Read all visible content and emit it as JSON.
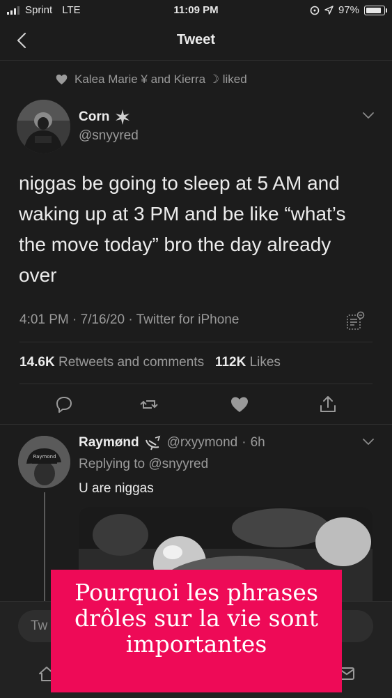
{
  "status": {
    "carrier": "Sprint",
    "network": "LTE",
    "time": "11:09 PM",
    "battery": "97%"
  },
  "header": {
    "title": "Tweet"
  },
  "liked_line": "Kalea Marie ¥ and Kierra ☽ liked",
  "tweet": {
    "author_name": "Corn",
    "author_handle": "@snyyred",
    "text": "niggas be going to sleep at 5 AM and waking up at 3 PM and be like “what’s the move today” bro the day already over",
    "meta": "4:01 PM · 7/16/20 · Twitter for iPhone",
    "retweets_count": "14.6K",
    "retweets_label": "Retweets and comments",
    "likes_count": "112K",
    "likes_label": "Likes"
  },
  "reply": {
    "name": "Raymønd",
    "handle": "@rxyymond",
    "time": "6h",
    "replying_to": "Replying to @snyyred",
    "text": "U are niggas",
    "avatar_cap_text": "Raymond"
  },
  "compose": {
    "placeholder": "Tw"
  },
  "banner": {
    "text": "Pourquoi les phrases drôles sur la vie sont importantes"
  },
  "icons": {
    "back": "chevron-left-icon",
    "heart_small": "heart-icon",
    "badge": "sparkle-badge-icon",
    "more": "chevron-down-icon",
    "analytics": "analytics-icon",
    "reply": "comment-icon",
    "retweet": "retweet-icon",
    "like": "heart-icon",
    "share": "share-icon",
    "home": "home-icon",
    "messages": "mail-icon"
  },
  "colors": {
    "background": "#1c1c1c",
    "banner": "#ee0a57",
    "text": "#ececec",
    "muted": "#9a9a9a"
  }
}
